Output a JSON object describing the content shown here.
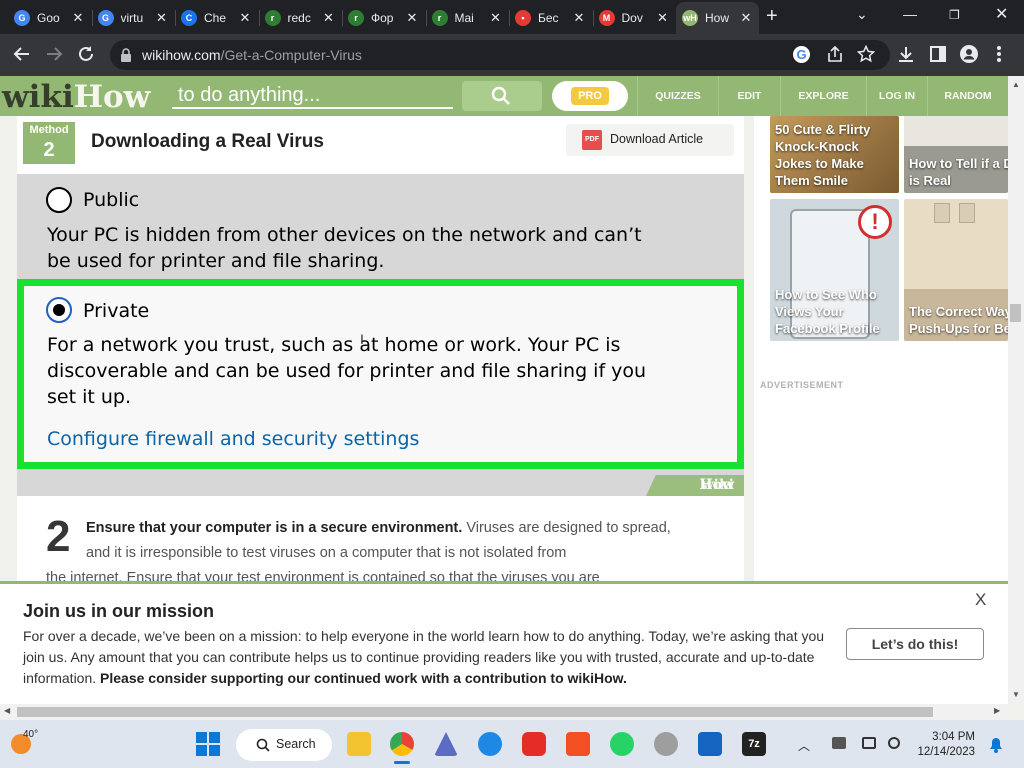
{
  "browser": {
    "tabs": [
      {
        "title": "Goo",
        "icon": "google-icon",
        "color": "#4285f4",
        "glyph": "G"
      },
      {
        "title": "virtu",
        "icon": "google-icon",
        "color": "#4285f4",
        "glyph": "G"
      },
      {
        "title": "Che",
        "icon": "site-icon",
        "color": "#1a73e8",
        "glyph": "C"
      },
      {
        "title": "redc",
        "icon": "redcap-icon",
        "color": "#2e7d32",
        "glyph": "r"
      },
      {
        "title": "Фор",
        "icon": "redcap-icon",
        "color": "#2e7d32",
        "glyph": "r"
      },
      {
        "title": "Mai",
        "icon": "redcap-icon",
        "color": "#2e7d32",
        "glyph": "r"
      },
      {
        "title": "Бес",
        "icon": "pin-icon",
        "color": "#e53935",
        "glyph": "•"
      },
      {
        "title": "Dov",
        "icon": "gmail-icon",
        "color": "#e53935",
        "glyph": "M"
      },
      {
        "title": "How",
        "icon": "wikihow-icon",
        "color": "#93b874",
        "glyph": "wH",
        "active": true
      }
    ],
    "url_domain": "wikihow.com",
    "url_path": "/Get-a-Computer-Virus"
  },
  "wikihow": {
    "logo_wiki": "wiki",
    "logo_how": "How",
    "search_placeholder": "to do anything...",
    "pro_label": "PRO",
    "nav": [
      "QUIZZES",
      "EDIT",
      "EXPLORE",
      "LOG IN",
      "RANDOM"
    ]
  },
  "article": {
    "method_label": "Method",
    "method_number": "2",
    "method_title": "Downloading a Real Virus",
    "download_label": "Download Article",
    "pdf_label": "PDF",
    "image": {
      "public_label": "Public",
      "public_desc": "Your PC is hidden from other devices on the network and can’t be used for printer and file sharing.",
      "private_label": "Private",
      "private_desc": "For a network you trust, such as at home or work. Your PC is discoverable and can be used for printer and file sharing if you set it up.",
      "firewall_link": "Configure firewall and security settings",
      "watermark_wiki": "wiki",
      "watermark_how": "How"
    },
    "step_number": "2",
    "step_bold": "Ensure that your computer is in a secure environment.",
    "step_text": " Viruses are designed to spread, and it is irresponsible to test viruses on a computer that is not isolated from",
    "step_text_cont": "the internet. Ensure that your test environment is contained so that the viruses you are"
  },
  "sidebar": {
    "related": [
      {
        "caption": "50 Cute & Flirty Knock-Knock Jokes to Make Them Smile"
      },
      {
        "caption": "How to Tell if a Diamond is Real"
      },
      {
        "caption": "How to See Who Views Your Facebook Profile"
      },
      {
        "caption": "The Correct Way to Do Push-Ups for Beginners"
      }
    ],
    "ad_label": "ADVERTISEMENT"
  },
  "banner": {
    "title": "Join us in our mission",
    "close": "X",
    "text": "For over a decade, we’ve been on a mission: to help everyone in the world learn how to do anything. Today, we’re asking that you join us. Any amount that you can contribute helps us to continue providing readers like you with trusted, accurate and up-to-date information. ",
    "text_bold": "Please consider supporting our continued work with a contribution to wikiHow.",
    "button": "Let’s do this!"
  },
  "taskbar": {
    "temperature": "40°",
    "search_label": "Search",
    "time": "3:04 PM",
    "date": "12/14/2023"
  },
  "colors": {
    "wikihow_green": "#93b874",
    "highlight_green": "#19e12f",
    "link_blue": "#0b64a8"
  }
}
